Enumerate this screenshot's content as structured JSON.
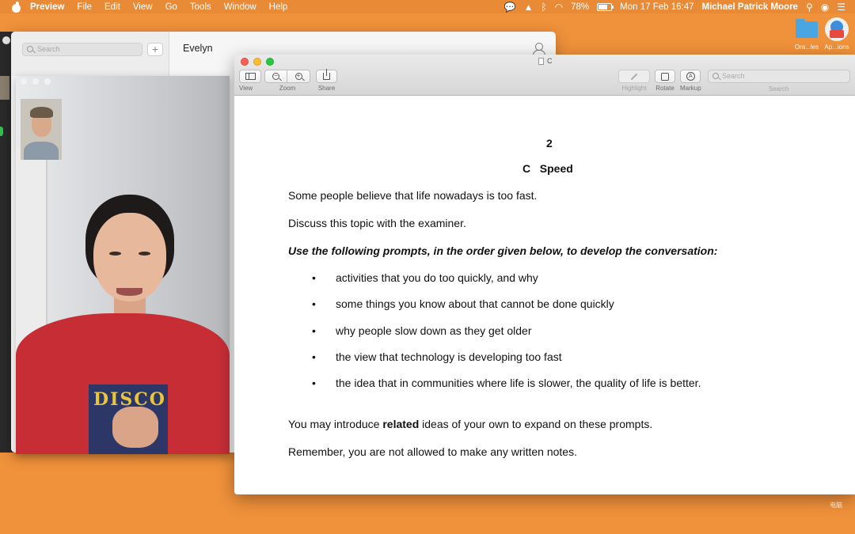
{
  "menubar": {
    "app_name": "Preview",
    "items": [
      "File",
      "Edit",
      "View",
      "Go",
      "Tools",
      "Window",
      "Help"
    ],
    "battery_percent": "78%",
    "battery_level": 0.78,
    "datetime": "Mon 17 Feb  16:47",
    "user": "Michael Patrick Moore"
  },
  "desktop": {
    "icons": [
      {
        "label": "Ora...les"
      },
      {
        "label": "Ap...ions"
      }
    ],
    "corner_text": "电脑"
  },
  "messages": {
    "search_placeholder": "Search",
    "compose_label": "+",
    "conversation_name": "Evelyn"
  },
  "facetime": {
    "shirt_print": "DISCO"
  },
  "preview": {
    "doc_title": "C",
    "toolbar": {
      "view_label": "View",
      "zoom_label": "Zoom",
      "share_label": "Share",
      "highlight_label": "Highlight",
      "rotate_label": "Rotate",
      "markup_label": "Markup",
      "search_label": "Search",
      "search_placeholder": "Search"
    },
    "document": {
      "page_number": "2",
      "heading": "C   Speed",
      "intro_1": "Some people believe that life nowadays is too fast.",
      "intro_2": "Discuss this topic with the examiner.",
      "instruction": "Use the following prompts, in the order given below, to develop the conversation:",
      "bullets": [
        "activities that you do too quickly, and why",
        "some things you know about that cannot be done quickly",
        "why people slow down as they get older",
        "the view that technology is developing too fast",
        "the idea that in communities where life is slower, the quality of life is better."
      ],
      "bullet_symbol": "•",
      "outro_prefix": "You may introduce ",
      "outro_bold": "related",
      "outro_suffix": " ideas of your own to expand on these prompts.",
      "reminder": "Remember, you are not allowed to make any written notes."
    }
  },
  "colors": {
    "desktop": "#F0913B",
    "accent_close": "#FC5F57",
    "accent_min": "#FDBC2E",
    "accent_max": "#28C840"
  }
}
